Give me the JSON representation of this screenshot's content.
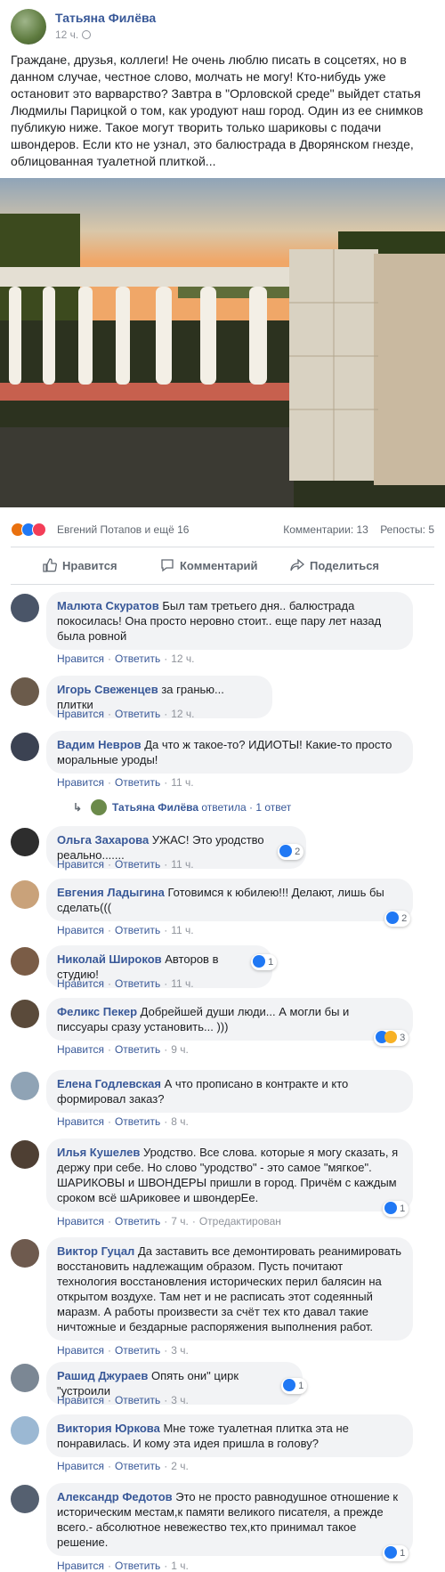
{
  "post": {
    "author": "Татьяна Филёва",
    "time": "12 ч.",
    "text": "Граждане, друзья, коллеги! Не очень люблю писать в соцсетях, но в данном случае, честное слово, молчать не могу! Кто-нибудь уже остановит это варварство? Завтра в \"Орловской среде\" выйдет статья Людмилы Парицкой о том, как уродуют наш город. Один из ее снимков публикую ниже. Такое могут творить только шариковы с подачи швондеров. Если кто не узнал, это балюстрада в Дворянском гнезде, облицованная туалетной плиткой..."
  },
  "reactions": {
    "people": "Евгений Потапов и ещё 16",
    "comments_count": "Комментарии: 13",
    "reposts_count": "Репосты: 5"
  },
  "actions": {
    "like": "Нравится",
    "comment": "Комментарий",
    "share": "Поделиться"
  },
  "comment_actions": {
    "like": "Нравится",
    "reply": "Ответить"
  },
  "comments": [
    {
      "name": "Малюта Скуратов",
      "text": "Был там третьего дня.. балюстрада покосилась! Она просто неровно стоит.. еще пару лет назад была ровной",
      "time": "12 ч."
    },
    {
      "name": "Игорь Свеженцев",
      "text": "за гранью... плитки",
      "time": "12 ч."
    },
    {
      "name": "Вадим Невров",
      "text": "Да что ж такое-то? ИДИОТЫ! Какие-то просто моральные уроды!",
      "time": "11 ч.",
      "reply_summary": {
        "name": "Татьяна Филёва",
        "text": "ответила · 1 ответ"
      }
    },
    {
      "name": "Ольга Захарова",
      "text": "УЖАС! Это уродство реально.......",
      "time": "11 ч.",
      "reactions": "2"
    },
    {
      "name": "Евгения Ладыгина",
      "text": "Готовимся к юбилею!!! Делают, лишь бы сделать(((",
      "time": "11 ч.",
      "reactions": "2"
    },
    {
      "name": "Николай Широков",
      "text": "Авторов в студию!",
      "time": "11 ч.",
      "reactions": "1"
    },
    {
      "name": "Феликс Пекер",
      "text": "Добрейшей души люди... А могли бы и писсуары сразу установить... )))",
      "time": "9 ч.",
      "reactions": "3"
    },
    {
      "name": "Елена Годлевская",
      "text": "А что прописано в контракте и кто формировал заказ?",
      "time": "8 ч."
    },
    {
      "name": "Илья Кушелев",
      "text": "Уродство. Все слова. которые я могу сказать, я держу при себе. Но слово \"уродство\" - это самое \"мягкое\". ШАРИКОВЫ и ШВОНДЕРЫ пришли в город. Причём с каждым сроком всё шАриковее и швондерЕе.",
      "time": "7 ч.",
      "edited": "Отредактирован",
      "reactions": "1"
    },
    {
      "name": "Виктор Гуцал",
      "text": "Да заставить все демонтировать реанимировать восстановить надлежащим образом. Пусть почитают технология восстановления исторических перил балясин на открытом воздухе. Там нет и не расписать этот содеянный маразм. А работы произвести за счёт тех кто давал такие ничтожные и бездарные распоряжения выполнения работ.",
      "time": "3 ч."
    },
    {
      "name": "Рашид Джураев",
      "text": "Опять они\" цирк \"устроили",
      "time": "3 ч.",
      "reactions": "1"
    },
    {
      "name": "Виктория Юркова",
      "text": "Мне тоже туалетная плитка эта не понравилась. И кому эта идея пришла в голову?",
      "time": "2 ч."
    },
    {
      "name": "Александр Федотов",
      "text": "Это не просто равнодушное отношение к историческим местам,к памяти великого писателя, а прежде всего.- абсолютное невежество тех,кто принимал такое решение.",
      "time": "1 ч.",
      "reactions": "1"
    }
  ],
  "colors": {
    "link": "#385898",
    "like_blue": "#2078f4",
    "bubble_bg": "#f2f3f5"
  }
}
